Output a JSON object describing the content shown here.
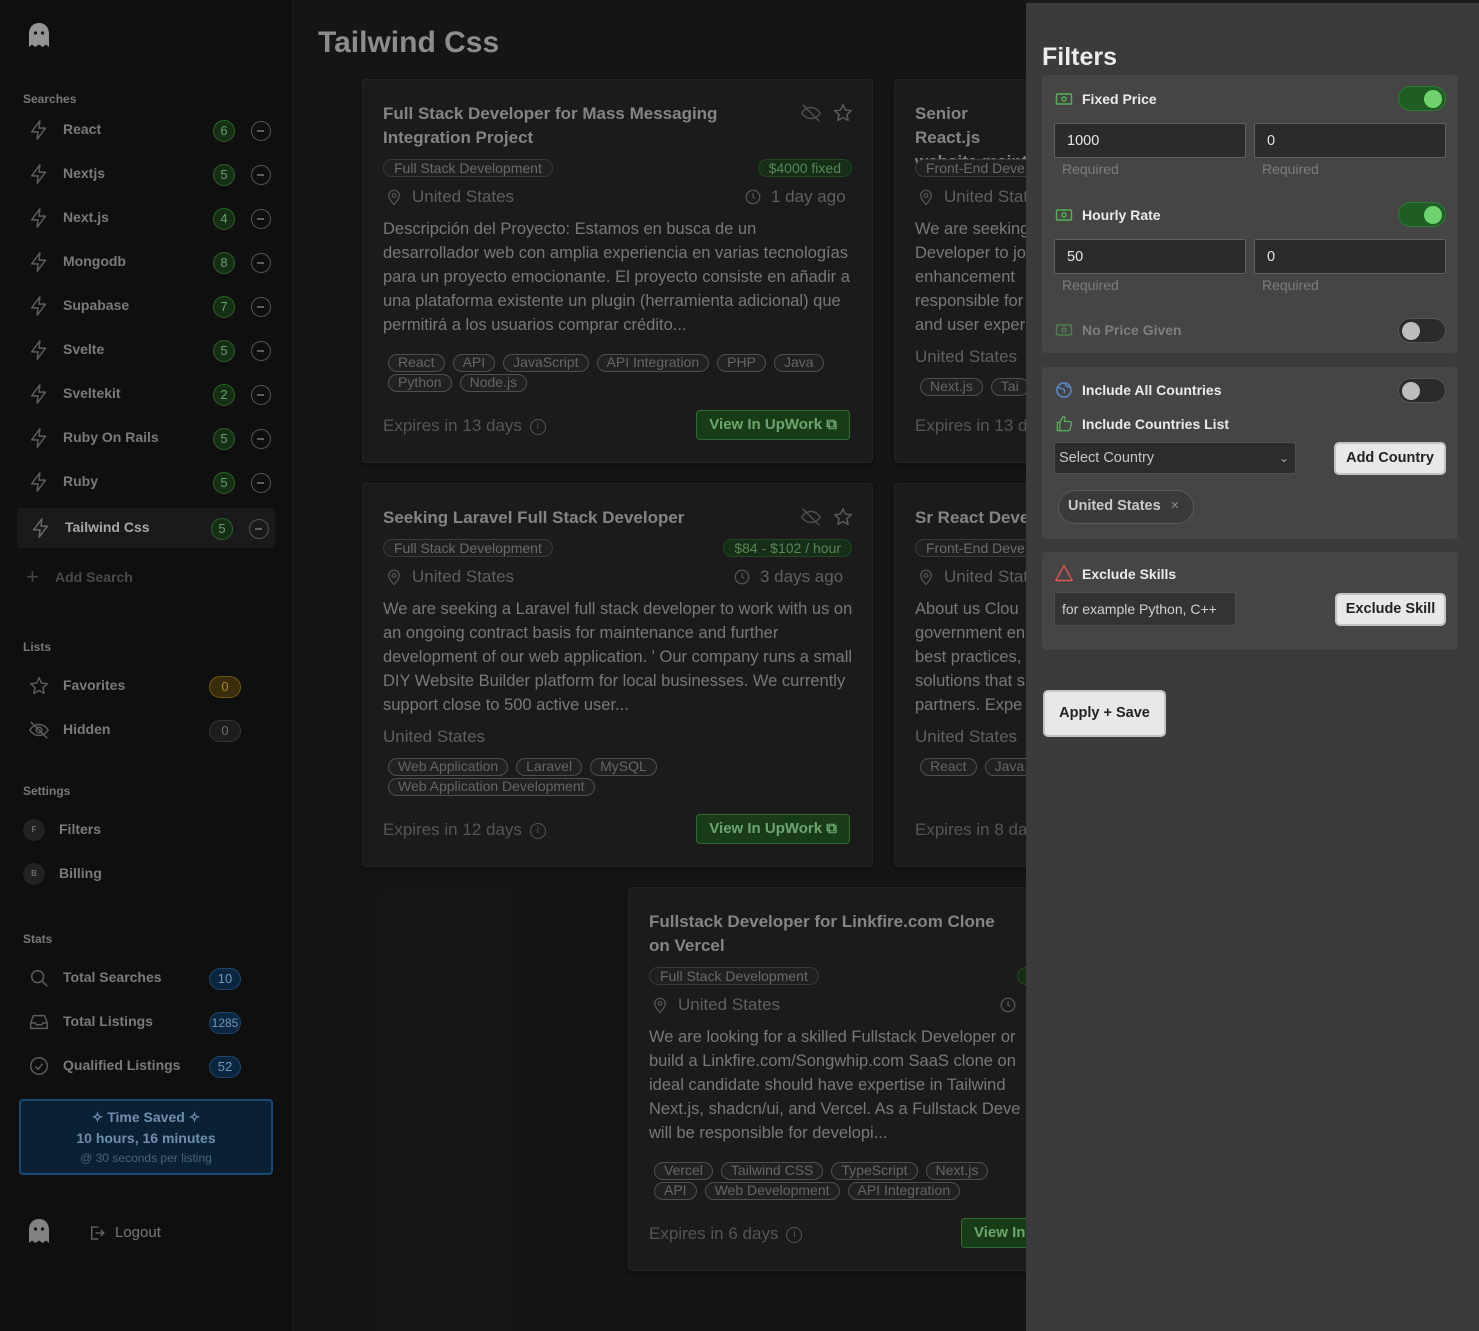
{
  "page_title": "Tailwind Css",
  "sidebar": {
    "searches_title": "Searches",
    "searches": [
      {
        "label": "React",
        "count": "6"
      },
      {
        "label": "Nextjs",
        "count": "5"
      },
      {
        "label": "Next.js",
        "count": "4"
      },
      {
        "label": "Mongodb",
        "count": "8"
      },
      {
        "label": "Supabase",
        "count": "7"
      },
      {
        "label": "Svelte",
        "count": "5"
      },
      {
        "label": "Sveltekit",
        "count": "2"
      },
      {
        "label": "Ruby On Rails",
        "count": "5"
      },
      {
        "label": "Ruby",
        "count": "5"
      },
      {
        "label": "Tailwind Css",
        "count": "5"
      }
    ],
    "add_search": "Add Search",
    "lists_title": "Lists",
    "lists": [
      {
        "label": "Favorites",
        "count": "0"
      },
      {
        "label": "Hidden",
        "count": "0"
      }
    ],
    "settings_title": "Settings",
    "settings": [
      {
        "letter": "F",
        "label": "Filters"
      },
      {
        "letter": "B",
        "label": "Billing"
      }
    ],
    "stats_title": "Stats",
    "stats": [
      {
        "label": "Total Searches",
        "count": "10"
      },
      {
        "label": "Total Listings",
        "count": "1285"
      },
      {
        "label": "Qualified Listings",
        "count": "52"
      }
    ],
    "time_saved": {
      "title": "Time Saved",
      "value": "10 hours, 16 minutes",
      "note": "@ 30 seconds per listing"
    },
    "logout": "Logout"
  },
  "cards": [
    {
      "title": "Full Stack Developer for Mass Messaging Integration Project",
      "category": "Full Stack Development",
      "price": "$4000 fixed",
      "location": "United States",
      "posted": "1 day ago",
      "description": "Descripción del Proyecto: Estamos en busca de un desarrollador web con amplia experiencia en varias tecnologías para un proyecto emocionante. El proyecto consiste en añadir a una plataforma existente un plugin (herramienta adicional) que permitirá a los usuarios comprar crédito...",
      "tags": [
        "React",
        "API",
        "JavaScript",
        "API Integration",
        "PHP",
        "Java",
        "Python",
        "Node.js"
      ],
      "expires": "Expires in 13 days",
      "button": "View In UpWork"
    },
    {
      "title": "Senior React.js website maint",
      "category": "Front-End Deve",
      "location": "United Stat",
      "description": "We are seeking Developer to jo enhancement responsible for and user exper",
      "location2": "United States",
      "tags": [
        "Next.js",
        "Tai"
      ],
      "expires": "Expires in 13 d"
    },
    {
      "title": "Seeking Laravel Full Stack Developer",
      "category": "Full Stack Development",
      "price": "$84 - $102 / hour",
      "location": "United States",
      "posted": "3 days ago",
      "description": "We are seeking a Laravel full stack developer to work with us on an ongoing contract basis for maintenance and further development of our web application. ' Our company runs a small DIY Website Builder platform for local businesses. We currently support close to 500 active user...",
      "location2": "United States",
      "tags": [
        "Web Application",
        "Laravel",
        "MySQL",
        "Web Application Development"
      ],
      "expires": "Expires in 12 days",
      "button": "View In UpWork"
    },
    {
      "title": "Sr React Devel",
      "category": "Front-End Deve",
      "location": "United Stat",
      "description": "About us Clou government en best practices, solutions that s partners. Expe",
      "location2": "United States",
      "tags": [
        "React",
        "Java"
      ],
      "expires": "Expires in 8 da"
    },
    {
      "title": "Fullstack Developer for Linkfire.com Clone on Vercel",
      "category": "Full Stack Development",
      "location": "United States",
      "description": "We are looking for a skilled Fullstack Developer or build a Linkfire.com/Songwhip.com SaaS clone on ideal candidate should have expertise in Tailwind Next.js, shadcn/ui, and Vercel. As a Fullstack Deve will be responsible for developi...",
      "tags": [
        "Vercel",
        "Tailwind CSS",
        "TypeScript",
        "Next.js",
        "API",
        "Web Development",
        "API Integration"
      ],
      "expires": "Expires in 6 days",
      "button": "View In"
    }
  ],
  "filters": {
    "title": "Filters",
    "fixed_price": {
      "label": "Fixed Price",
      "enabled": true,
      "min": "1000",
      "max": "0",
      "min_hint": "Required",
      "max_hint": "Required"
    },
    "hourly_rate": {
      "label": "Hourly Rate",
      "enabled": true,
      "min": "50",
      "max": "0",
      "min_hint": "Required",
      "max_hint": "Required"
    },
    "no_price": {
      "label": "No Price Given",
      "enabled": false
    },
    "include_all_countries": {
      "label": "Include All Countries",
      "enabled": false
    },
    "include_countries_list": "Include Countries List",
    "select_country": "Select Country",
    "add_country": "Add Country",
    "country_chip": "United States",
    "exclude_skills": "Exclude Skills",
    "skill_placeholder": "for example Python, C++",
    "exclude_skill_button": "Exclude Skill",
    "apply_save": "Apply + Save"
  },
  "colors": {
    "accent_green": "#3f8a3f",
    "badge_blue": "#1e5f99",
    "panel_bg": "#3b3b3b"
  }
}
